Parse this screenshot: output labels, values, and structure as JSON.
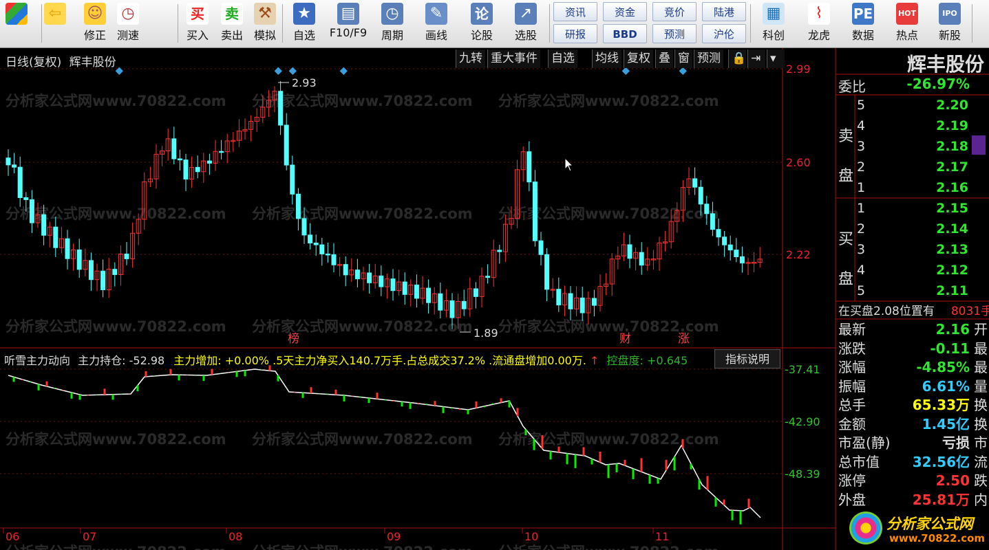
{
  "toolbar": {
    "big": [
      {
        "label": "",
        "icon": "windows-icon"
      },
      {
        "label": "",
        "icon": "back-arrow-icon"
      },
      {
        "label": "修正",
        "icon": "smile-icon"
      },
      {
        "label": "测速",
        "icon": "clock-icon"
      },
      {
        "label": "买入",
        "icon": "buy-icon",
        "glyph": "买"
      },
      {
        "label": "卖出",
        "icon": "sell-icon",
        "glyph": "卖"
      },
      {
        "label": "模拟",
        "icon": "hammer-icon"
      },
      {
        "label": "自选",
        "icon": "star-icon"
      },
      {
        "label": "F10/F9",
        "icon": "f10-icon"
      },
      {
        "label": "周期",
        "icon": "period-icon"
      },
      {
        "label": "画线",
        "icon": "pen-icon"
      },
      {
        "label": "论股",
        "icon": "discuss-icon",
        "glyph": "论"
      },
      {
        "label": "选股",
        "icon": "select-icon"
      },
      {
        "label": "科创",
        "icon": "chart-icon"
      },
      {
        "label": "龙虎",
        "icon": "dragon-icon"
      },
      {
        "label": "数据",
        "icon": "pe-icon",
        "glyph": "PE"
      },
      {
        "label": "热点",
        "icon": "hot-icon",
        "glyph": "HOT"
      },
      {
        "label": "新股",
        "icon": "ipo-icon",
        "glyph": "IPO"
      }
    ],
    "small": [
      [
        "资讯",
        "资金",
        "竞价",
        "陆港"
      ],
      [
        "研报",
        "BBD",
        "预测",
        "沪伦"
      ]
    ]
  },
  "header": {
    "mode": "日线(复权)",
    "name": "辉丰股份"
  },
  "tabs": [
    "九转",
    "重大事件",
    "自选",
    "均线",
    "复权",
    "叠",
    "窗",
    "预测"
  ],
  "price_axis": [
    "2.99",
    "2.60",
    "2.22"
  ],
  "annot": {
    "high": "2.93",
    "low": "1.89",
    "tags": [
      "榜",
      "财",
      "涨"
    ]
  },
  "indicator": {
    "name": "听雪主力动向",
    "hold_label": "主力持仓:",
    "hold_value": "-52.98",
    "info": "主力增加: +0.00% .5天主力净买入140.7万手.占总成交37.2% .流通盘增加0.00万.",
    "arrow": "↑",
    "ctrl_label": "控盘度:",
    "ctrl_value": "+0.645",
    "btn": "指标说明",
    "axis": [
      "-37.41",
      "-42.90",
      "-48.39"
    ]
  },
  "months": [
    "06",
    "07",
    "08",
    "09",
    "10",
    "11"
  ],
  "watermark": "分析家公式网www.70822.com",
  "right": {
    "title": "辉丰股份",
    "wb_label": "委比",
    "wb_value": "-26.97%",
    "sell_label": "卖盘",
    "buy_label": "买盘",
    "sell": [
      {
        "n": "5",
        "p": "2.20"
      },
      {
        "n": "4",
        "p": "2.19"
      },
      {
        "n": "3",
        "p": "2.18"
      },
      {
        "n": "2",
        "p": "2.17"
      },
      {
        "n": "1",
        "p": "2.16"
      }
    ],
    "buy": [
      {
        "n": "1",
        "p": "2.15"
      },
      {
        "n": "2",
        "p": "2.14"
      },
      {
        "n": "3",
        "p": "2.13"
      },
      {
        "n": "4",
        "p": "2.12"
      },
      {
        "n": "5",
        "p": "2.11"
      }
    ],
    "notice": "在买盘2.08位置有",
    "notice_num": "8031手",
    "quotes": [
      {
        "k": "最新",
        "v": "2.16",
        "c": "#31e631",
        "e": "开"
      },
      {
        "k": "涨跌",
        "v": "-0.11",
        "c": "#31e631",
        "e": "最"
      },
      {
        "k": "涨幅",
        "v": "-4.85%",
        "c": "#31e631",
        "e": "最"
      },
      {
        "k": "振幅",
        "v": "6.61%",
        "c": "#3cf",
        "e": "量"
      },
      {
        "k": "总手",
        "v": "65.33万",
        "c": "#ff0",
        "e": "换"
      },
      {
        "k": "金额",
        "v": "1.45亿",
        "c": "#3cf",
        "e": "换"
      },
      {
        "k": "市盈(静)",
        "v": "亏损",
        "c": "#ddd",
        "e": "市"
      },
      {
        "k": "总市值",
        "v": "32.56亿",
        "c": "#3cf",
        "e": "流"
      },
      {
        "k": "涨停",
        "v": "2.50",
        "c": "#f33",
        "e": "跌"
      },
      {
        "k": "外盘",
        "v": "25.81万",
        "c": "#f33",
        "e": "内"
      }
    ]
  },
  "logo": {
    "text": "分析家公式网",
    "url": "www.70822.com"
  },
  "colors": {
    "up": "#ff3232",
    "down": "#54ffff",
    "grid": "#aa1111",
    "line": "#ffffff",
    "green": "#00ee00"
  }
}
